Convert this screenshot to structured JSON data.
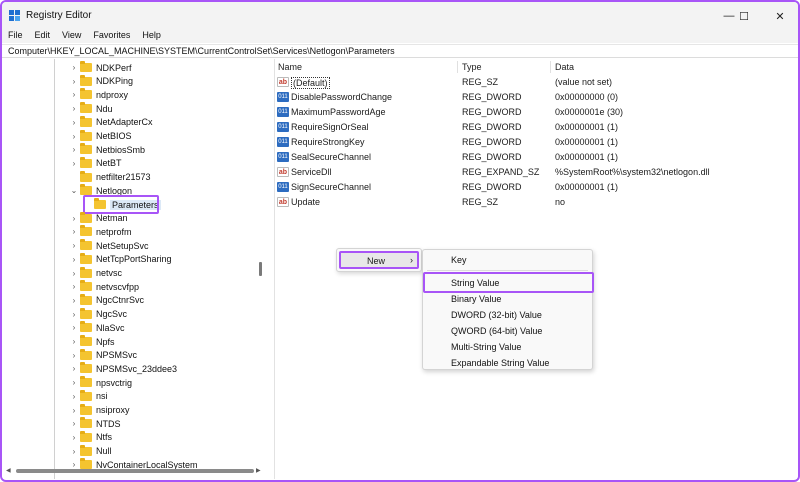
{
  "window": {
    "title": "Registry Editor",
    "controls": {
      "minimize": "—",
      "maximize": "☐",
      "close": "✕"
    }
  },
  "menubar": [
    "File",
    "Edit",
    "View",
    "Favorites",
    "Help"
  ],
  "address": "Computer\\HKEY_LOCAL_MACHINE\\SYSTEM\\CurrentControlSet\\Services\\Netlogon\\Parameters",
  "tree": {
    "items": [
      {
        "label": "NDKPerf",
        "expandable": true
      },
      {
        "label": "NDKPing",
        "expandable": true
      },
      {
        "label": "ndproxy",
        "expandable": true
      },
      {
        "label": "Ndu",
        "expandable": true
      },
      {
        "label": "NetAdapterCx",
        "expandable": true
      },
      {
        "label": "NetBIOS",
        "expandable": true
      },
      {
        "label": "NetbiosSmb",
        "expandable": true
      },
      {
        "label": "NetBT",
        "expandable": true
      },
      {
        "label": "netfilter21573",
        "expandable": false
      },
      {
        "label": "Netlogon",
        "expandable": true,
        "expanded": true
      },
      {
        "label": "Parameters",
        "expandable": false,
        "selected": true,
        "child": true
      },
      {
        "label": "Netman",
        "expandable": true
      },
      {
        "label": "netprofm",
        "expandable": true
      },
      {
        "label": "NetSetupSvc",
        "expandable": true
      },
      {
        "label": "NetTcpPortSharing",
        "expandable": true
      },
      {
        "label": "netvsc",
        "expandable": true
      },
      {
        "label": "netvscvfpp",
        "expandable": true
      },
      {
        "label": "NgcCtnrSvc",
        "expandable": true
      },
      {
        "label": "NgcSvc",
        "expandable": true
      },
      {
        "label": "NlaSvc",
        "expandable": true
      },
      {
        "label": "Npfs",
        "expandable": true
      },
      {
        "label": "NPSMSvc",
        "expandable": true
      },
      {
        "label": "NPSMSvc_23ddee3",
        "expandable": true
      },
      {
        "label": "npsvctrig",
        "expandable": true
      },
      {
        "label": "nsi",
        "expandable": true
      },
      {
        "label": "nsiproxy",
        "expandable": true
      },
      {
        "label": "NTDS",
        "expandable": true
      },
      {
        "label": "Ntfs",
        "expandable": true
      },
      {
        "label": "Null",
        "expandable": true
      },
      {
        "label": "NvContainerLocalSystem",
        "expandable": true
      }
    ]
  },
  "values": {
    "columns": [
      "Name",
      "Type",
      "Data"
    ],
    "rows": [
      {
        "name": "(Default)",
        "type": "REG_SZ",
        "data": "(value not set)",
        "icon": "ab"
      },
      {
        "name": "DisablePasswordChange",
        "type": "REG_DWORD",
        "data": "0x00000000 (0)",
        "icon": "011"
      },
      {
        "name": "MaximumPasswordAge",
        "type": "REG_DWORD",
        "data": "0x0000001e (30)",
        "icon": "011"
      },
      {
        "name": "RequireSignOrSeal",
        "type": "REG_DWORD",
        "data": "0x00000001 (1)",
        "icon": "011"
      },
      {
        "name": "RequireStrongKey",
        "type": "REG_DWORD",
        "data": "0x00000001 (1)",
        "icon": "011"
      },
      {
        "name": "SealSecureChannel",
        "type": "REG_DWORD",
        "data": "0x00000001 (1)",
        "icon": "011"
      },
      {
        "name": "ServiceDll",
        "type": "REG_EXPAND_SZ",
        "data": "%SystemRoot%\\system32\\netlogon.dll",
        "icon": "ab"
      },
      {
        "name": "SignSecureChannel",
        "type": "REG_DWORD",
        "data": "0x00000001 (1)",
        "icon": "011"
      },
      {
        "name": "Update",
        "type": "REG_SZ",
        "data": "no",
        "icon": "ab"
      }
    ]
  },
  "context_menu": {
    "new_label": "New",
    "arrow": "›",
    "submenu": [
      "Key",
      "String Value",
      "Binary Value",
      "DWORD (32-bit) Value",
      "QWORD (64-bit) Value",
      "Multi-String Value",
      "Expandable String Value"
    ]
  },
  "colors": {
    "highlight": "#a855f7",
    "folder": "#f4c430"
  }
}
